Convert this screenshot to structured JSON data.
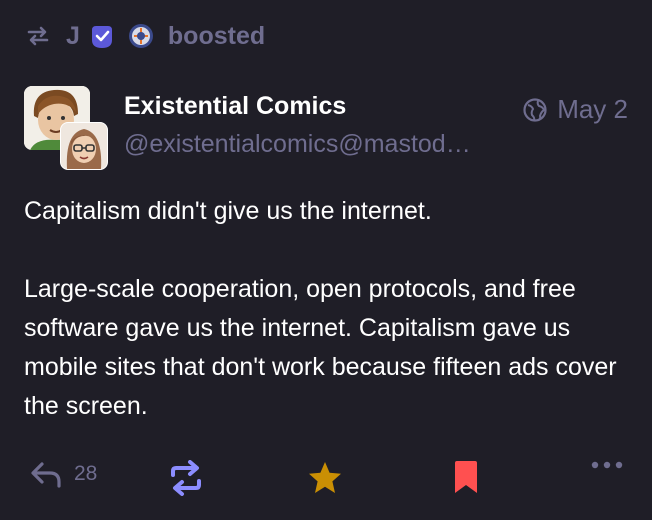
{
  "boost": {
    "booster_initial": "J",
    "label": "boosted"
  },
  "author": {
    "display_name": "Existential Comics",
    "handle": "@existentialcomics@mastod…"
  },
  "meta": {
    "visibility_icon": "globe-icon",
    "date": "May 2"
  },
  "content": {
    "paragraphs": [
      "Capitalism didn't give us the internet.",
      "Large-scale cooperation, open protocols, and free software gave us the internet. Capitalism gave us mobile sites that don't work because fifteen ads cover the screen."
    ]
  },
  "actions": {
    "reply_count": "28",
    "icons": [
      "reply-icon",
      "boost-icon",
      "favourite-icon",
      "bookmark-icon",
      "more-icon"
    ]
  },
  "colors": {
    "background": "#1f1e27",
    "muted": "#6f6d8f",
    "boost_active": "#8c8dff",
    "favourite_active": "#ca8f04",
    "bookmark_active": "#ff5050",
    "verified": "#5c59d9"
  }
}
